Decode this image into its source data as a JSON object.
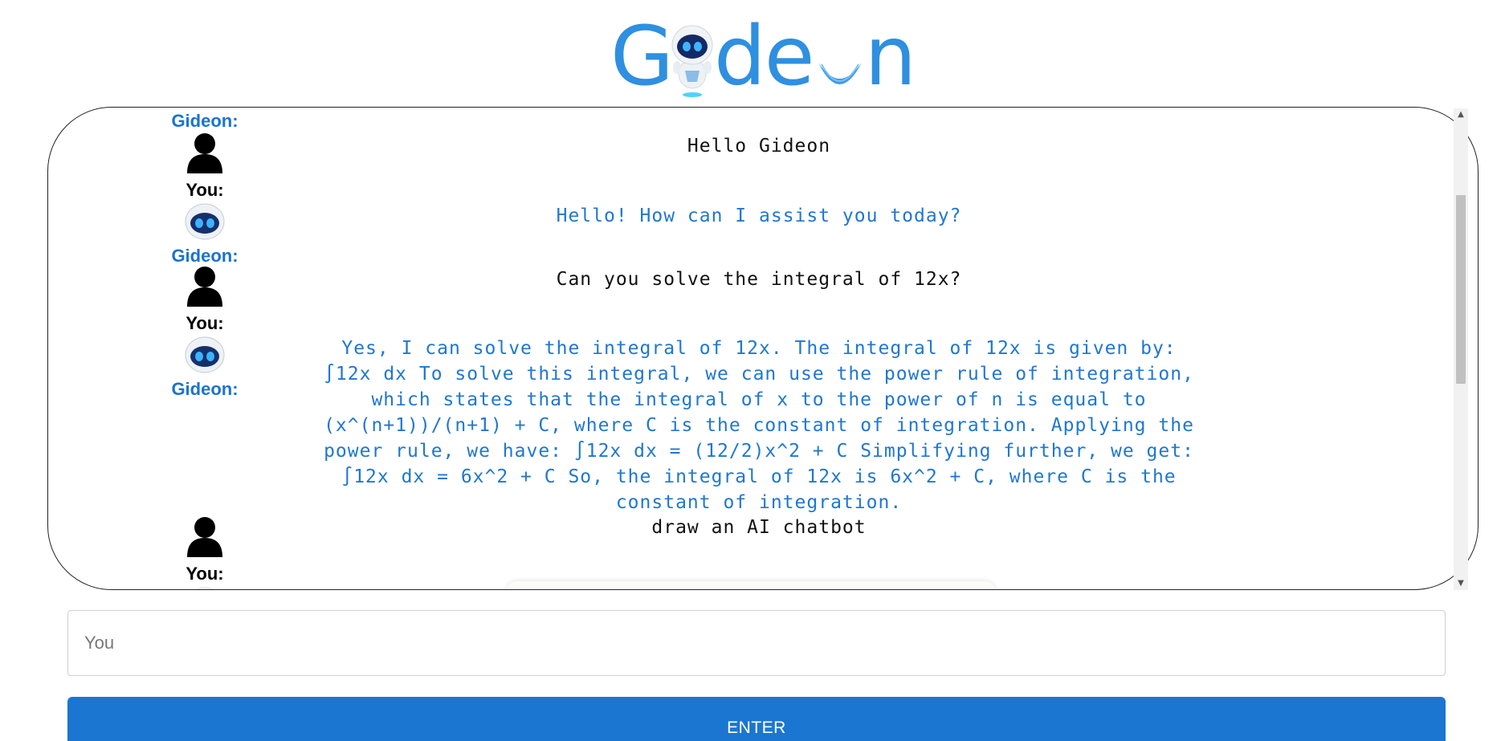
{
  "app": {
    "logo_letters": [
      "G",
      "de",
      "n"
    ],
    "brand_color": "#2f8fe0"
  },
  "chat": {
    "rows": [
      {
        "label": "Gideon:",
        "label_role": "bot"
      },
      {
        "avatar": "user-avatar-icon",
        "label": "You:",
        "label_role": "user",
        "message": "Hello Gideon",
        "message_role": "user"
      },
      {
        "avatar": "robot-avatar-icon",
        "label": "Gideon:",
        "label_role": "bot",
        "message": "Hello! How can I assist you today?",
        "message_role": "bot"
      },
      {
        "avatar": "user-avatar-icon",
        "label": "You:",
        "label_role": "user",
        "message": "Can you solve the integral of 12x?",
        "message_role": "user"
      },
      {
        "avatar": "robot-avatar-icon",
        "label": "Gideon:",
        "label_role": "bot",
        "message": "Yes, I can solve the integral of 12x. The integral of 12x is given by: ∫12x dx To solve this integral, we can use the power rule of integration, which states that the integral of x to the power of n is equal to (x^(n+1))/(n+1) + C, where C is the constant of integration. Applying the power rule, we have: ∫12x dx = (12/2)x^2 + C Simplifying further, we get: ∫12x dx = 6x^2 + C So, the integral of 12x is 6x^2 + C, where C is the constant of integration.",
        "message_role": "bot"
      },
      {
        "avatar": "user-avatar-icon",
        "label": "You:",
        "label_role": "user",
        "message": "draw an AI chatbot",
        "message_role": "user"
      }
    ],
    "bot_color": "#1f77d1",
    "bot_label_color": "#1a73cf"
  },
  "input": {
    "placeholder": "You",
    "value": ""
  },
  "enter_button": {
    "label": "ENTER",
    "color": "#1b76d2"
  }
}
